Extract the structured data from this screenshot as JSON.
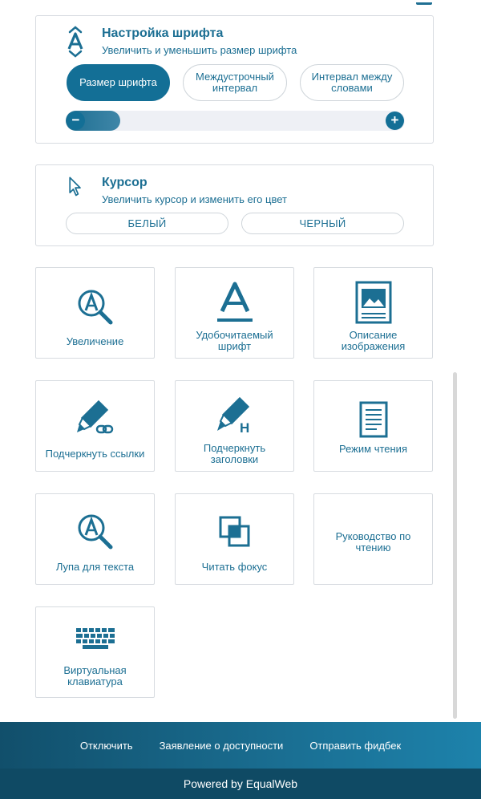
{
  "font_panel": {
    "title": "Настройка шрифта",
    "subtitle": "Увеличить и уменьшить размер шрифта",
    "buttons": [
      {
        "label": "Размер шрифта",
        "active": true
      },
      {
        "label": "Междустрочный интервал",
        "active": false
      },
      {
        "label": "Интервал между словами",
        "active": false
      }
    ],
    "slider": {
      "minus": "−",
      "plus": "+",
      "level": 0.16
    }
  },
  "cursor_panel": {
    "title": "Курсор",
    "subtitle": "Увеличить курсор и изменить его цвет",
    "options": [
      "БЕЛЫЙ",
      "ЧЕРНЫЙ"
    ]
  },
  "tiles": [
    {
      "label": "Увеличение",
      "icon": "magnifier-a-icon"
    },
    {
      "label": "Удобочитаемый шрифт",
      "icon": "readable-font-icon"
    },
    {
      "label": "Описание изображения",
      "icon": "image-description-icon"
    },
    {
      "label": "Подчеркнуть ссылки",
      "icon": "marker-link-icon"
    },
    {
      "label": "Подчеркнуть заголовки",
      "icon": "marker-heading-icon"
    },
    {
      "label": "Режим чтения",
      "icon": "document-icon"
    },
    {
      "label": "Лупа для текста",
      "icon": "text-magnifier-icon"
    },
    {
      "label": "Читать фокус",
      "icon": "focus-squares-icon"
    },
    {
      "label": "Руководство по чтению",
      "icon": ""
    },
    {
      "label": "Виртуальная клавиатура",
      "icon": "keyboard-icon"
    }
  ],
  "footer": {
    "links": [
      "Отключить",
      "Заявление о доступности",
      "Отправить фидбек"
    ],
    "powered": "Powered by EqualWeb"
  },
  "colors": {
    "accent": "#136f96",
    "text": "#1c6f93",
    "footer_dark": "#0f4a64"
  }
}
